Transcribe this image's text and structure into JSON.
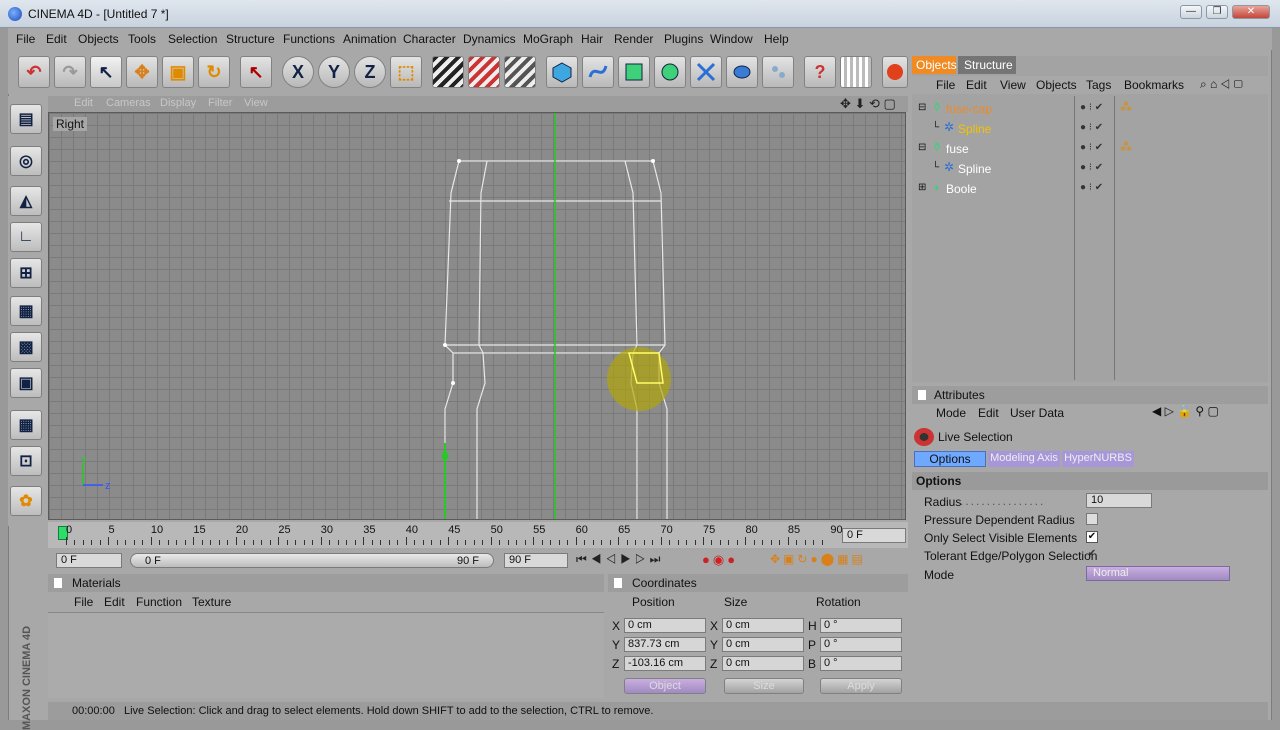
{
  "window": {
    "title": "CINEMA 4D - [Untitled 7 *]",
    "controls": [
      "—",
      "❐",
      "✕"
    ]
  },
  "menu": [
    "File",
    "Edit",
    "Objects",
    "Tools",
    "Selection",
    "Structure",
    "Functions",
    "Animation",
    "Character",
    "Dynamics",
    "MoGraph",
    "Hair",
    "Render",
    "Plugins",
    "Window",
    "Help"
  ],
  "toolbar_icons": [
    "undo-icon",
    "redo-icon",
    "live-select-icon",
    "move-icon",
    "scale-icon",
    "rotate-icon",
    "last-tool-icon",
    "x-axis-icon",
    "y-axis-icon",
    "z-axis-icon",
    "coordinate-system-icon",
    "render-view-icon",
    "render-picture-viewer-icon",
    "render-settings-icon",
    "cube-icon",
    "spline-icon",
    "nurbs-icon",
    "modeling-icon",
    "deformer-icon",
    "scene-icon",
    "camera-icon",
    "light-icon",
    "help-icon",
    "content-browser-icon",
    "render-sphere-icon"
  ],
  "toolbar_glyphs": {
    "undo": "↶",
    "redo": "↷",
    "select": "↖",
    "move": "✥",
    "scale": "▣",
    "rotate": "↻",
    "last": "↖",
    "x": "X",
    "y": "Y",
    "z": "Z",
    "coord": "⬚",
    "help": "?"
  },
  "viewport": {
    "menu": [
      "Edit",
      "Cameras",
      "Display",
      "Filter",
      "View"
    ],
    "label": "Right",
    "axes": {
      "y": "y",
      "z": "z"
    }
  },
  "timeline": {
    "ticks": [
      "0",
      "5",
      "10",
      "15",
      "20",
      "25",
      "30",
      "35",
      "40",
      "45",
      "50",
      "55",
      "60",
      "65",
      "70",
      "75",
      "80",
      "85",
      "90"
    ],
    "frame_field": "0 F"
  },
  "transport": {
    "start": "0 F",
    "slider_start": "0 F",
    "slider_end": "90 F",
    "end": "90 F"
  },
  "object_manager": {
    "tabs": [
      "Objects",
      "Structure"
    ],
    "active_tab": "Objects",
    "menu": [
      "File",
      "Edit",
      "View",
      "Objects",
      "Tags",
      "Bookmarks"
    ],
    "objects": [
      {
        "name": "fuse-cap",
        "indent": 0,
        "highlighted": true,
        "icon": "lathe-icon"
      },
      {
        "name": "Spline",
        "indent": 1,
        "highlighted": true,
        "icon": "spline-icon"
      },
      {
        "name": "fuse",
        "indent": 0,
        "highlighted": false,
        "icon": "lathe-icon"
      },
      {
        "name": "Spline",
        "indent": 1,
        "highlighted": false,
        "icon": "spline-icon"
      },
      {
        "name": "Boole",
        "indent": 0,
        "highlighted": false,
        "icon": "boole-icon"
      }
    ]
  },
  "attributes": {
    "title": "Attributes",
    "menu": [
      "Mode",
      "Edit",
      "User Data"
    ],
    "tool": "Live Selection",
    "tabs": [
      "Options",
      "Modeling Axis",
      "HyperNURBS"
    ],
    "active_tab": "Options",
    "section": "Options",
    "radius_label": "Radius",
    "radius_value": "10",
    "pressure_label": "Pressure Dependent Radius",
    "pressure_checked": false,
    "visible_label": "Only Select Visible Elements",
    "visible_checked": true,
    "tolerant_label": "Tolerant Edge/Polygon Selection",
    "tolerant_checked": true,
    "mode_label": "Mode",
    "mode_value": "Normal"
  },
  "materials": {
    "title": "Materials",
    "menu": [
      "File",
      "Edit",
      "Function",
      "Texture"
    ]
  },
  "coordinates": {
    "title": "Coordinates",
    "headers": [
      "Position",
      "Size",
      "Rotation"
    ],
    "rows": [
      {
        "pl": "X",
        "p": "0 cm",
        "sl": "X",
        "s": "0 cm",
        "rl": "H",
        "r": "0 °"
      },
      {
        "pl": "Y",
        "p": "837.73 cm",
        "sl": "Y",
        "s": "0 cm",
        "rl": "P",
        "r": "0 °"
      },
      {
        "pl": "Z",
        "p": "-103.16 cm",
        "sl": "Z",
        "s": "0 cm",
        "rl": "B",
        "r": "0 °"
      }
    ],
    "object_dropdown": "Object",
    "size_dropdown": "Size",
    "apply": "Apply"
  },
  "status": {
    "time": "00:00:00",
    "message": "Live Selection: Click and drag to select elements. Hold down SHIFT to add to the selection, CTRL to remove."
  },
  "branding": "MAXON CINEMA 4D",
  "colors": {
    "accent": "#f08a23",
    "selection": "#e8e8e8",
    "axis_y": "#22cc22",
    "axis_z": "#3355ff",
    "axis_x": "#cc2222",
    "hover_brush": "#b3a800"
  }
}
